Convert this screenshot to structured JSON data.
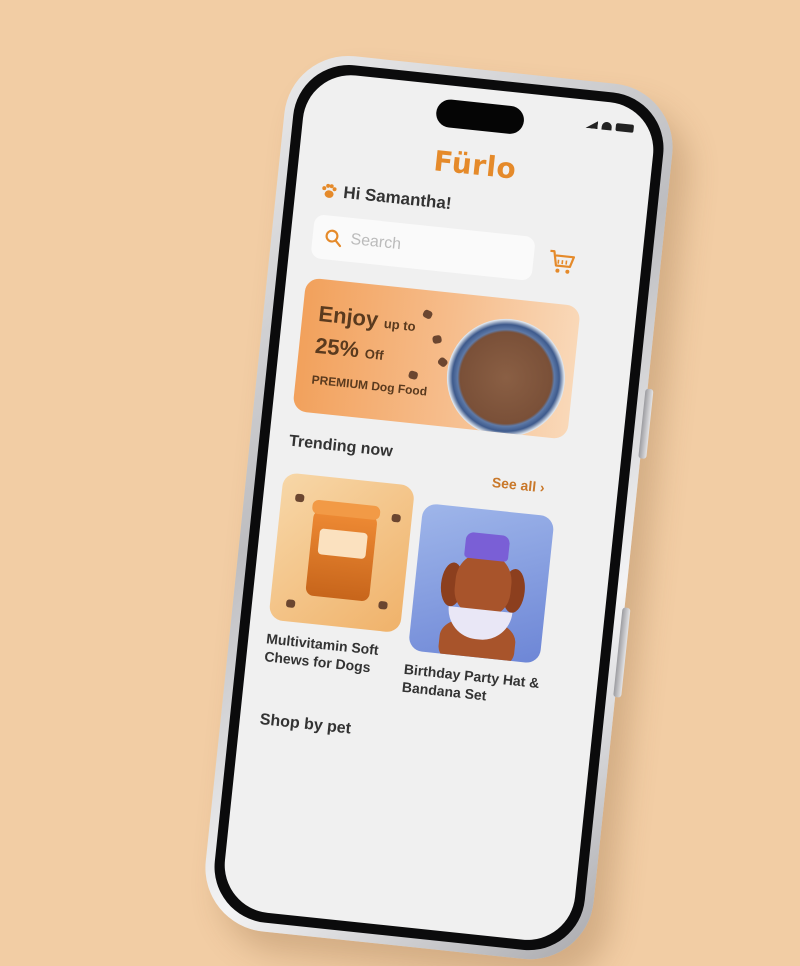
{
  "app": {
    "logo_text": "Fürlo"
  },
  "greeting": "Hi Samantha!",
  "search": {
    "placeholder": "Search"
  },
  "banner": {
    "line1_big": "Enjoy",
    "line1_small": "up to",
    "line2_big": "25%",
    "line2_small": "Off",
    "subtitle": "PREMIUM Dog Food"
  },
  "trending": {
    "title": "Trending now",
    "see_all": "See all ›",
    "items": [
      {
        "title_line1": "Multivitamin Soft",
        "title_line2": "Chews for Dogs"
      },
      {
        "title_line1": "Birthday Party Hat &",
        "title_line2": "Bandana Set"
      }
    ]
  },
  "shop_by_pet": {
    "title": "Shop by pet"
  },
  "colors": {
    "accent": "#e58a2a",
    "background": "#f2cda4",
    "banner": "#f2a15c"
  },
  "icons": [
    "paw-icon",
    "search-icon",
    "cart-icon",
    "chevron-right-icon",
    "signal-icon",
    "wifi-icon",
    "battery-icon"
  ]
}
